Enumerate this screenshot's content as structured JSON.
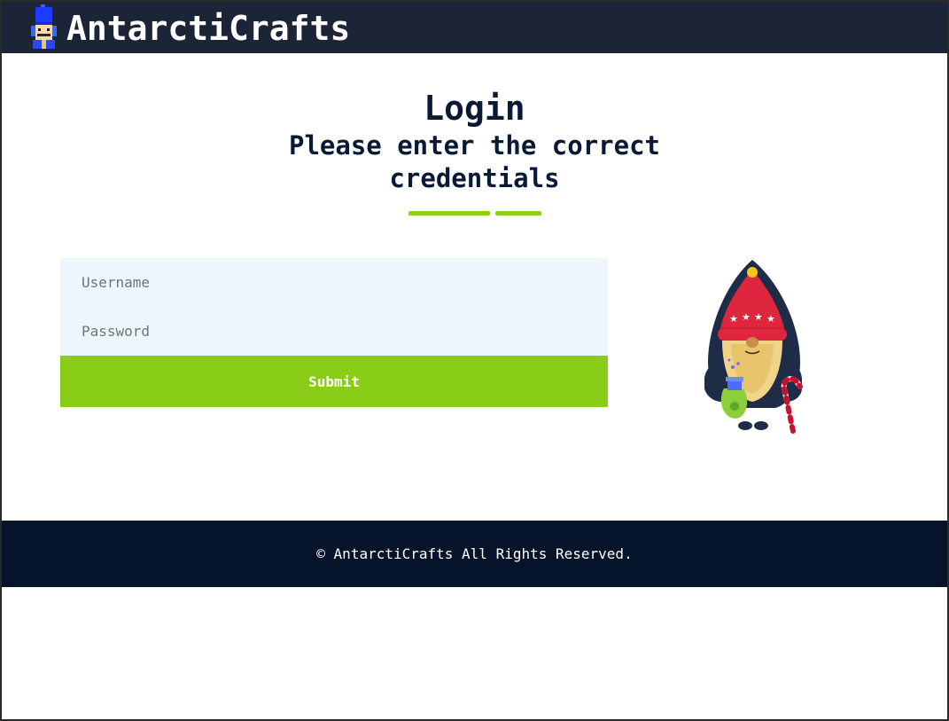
{
  "header": {
    "brand": "AntarctiCrafts",
    "logo_icon": "nutcracker-soldier-icon"
  },
  "login": {
    "title": "Login",
    "subtitle": "Please enter the correct credentials",
    "username_placeholder": "Username",
    "password_placeholder": "Password",
    "submit_label": "Submit"
  },
  "illustration": {
    "icon": "gnome-elf-with-candy-cane-illustration"
  },
  "footer": {
    "copyright": "© AntarctiCrafts All Rights Reserved."
  },
  "colors": {
    "navbar": "#1c2438",
    "footer": "#05142a",
    "accent": "#8acd19",
    "input_bg": "#edf6fd",
    "heading": "#0a1935"
  }
}
